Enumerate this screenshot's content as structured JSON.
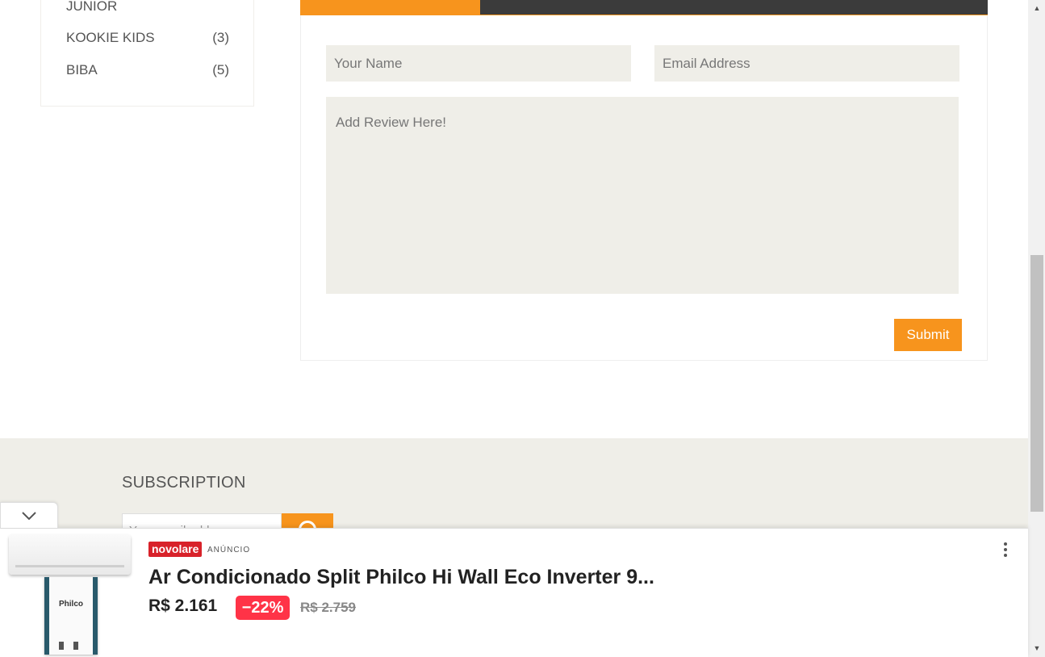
{
  "sidebar": {
    "brands": [
      {
        "name": "JUNIOR",
        "count": ""
      },
      {
        "name": "KOOKIE KIDS",
        "count": "(3)"
      },
      {
        "name": "BIBA",
        "count": "(5)"
      }
    ]
  },
  "review_form": {
    "name_placeholder": "Your Name",
    "email_placeholder": "Email Address",
    "review_placeholder": "Add Review Here!",
    "submit_label": "Submit"
  },
  "footer": {
    "subscription_title": "SUBSCRIPTION",
    "email_placeholder": "Your email address"
  },
  "ad": {
    "brand": "novolare",
    "tag": "ANÚNCIO",
    "product_image_label": "Philco",
    "title": "Ar Condicionado Split Philco Hi Wall Eco Inverter 9...",
    "price": "R$ 2.161",
    "discount": "−22%",
    "old_price": "R$ 2.759"
  },
  "colors": {
    "accent": "#f7941d",
    "dark_tab": "#3b3b3b",
    "field_bg": "#efeee8",
    "discount_red": "#ff3347",
    "brand_red": "#d8222a"
  }
}
